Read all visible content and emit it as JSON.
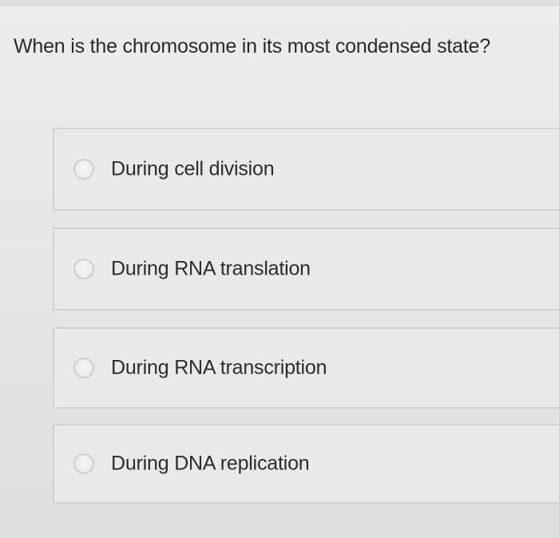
{
  "question": {
    "text": "When is the chromosome in its most condensed state?"
  },
  "options": [
    {
      "label": "During cell division"
    },
    {
      "label": "During RNA translation"
    },
    {
      "label": "During RNA transcription"
    },
    {
      "label": "During DNA replication"
    }
  ]
}
